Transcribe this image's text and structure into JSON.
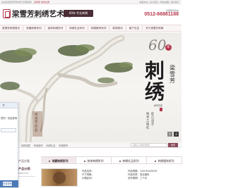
{
  "topbar": {
    "welcome": "欢迎来到梁雪芳刺绣艺术网官网！",
    "login": "请登录",
    "register": "免费注册",
    "links": "收藏本站 | 设为首页 | 网站地图 | 联系我们"
  },
  "header": {
    "logo_text": "梁雪芳刺绣艺术网",
    "logo_sub": "LIANGXUEFANG EMBROIDERY ART",
    "slogan": "60年·专业刺绣",
    "hotline_label": "全国服务热线",
    "hotline_number": "0512-66881188"
  },
  "nav": {
    "items": [
      "梁雪芳刺绣首页",
      "收藏刺绣系列",
      "装饰刺绣系列",
      "刺绣礼品系列",
      "刺绣服饰系列",
      "新闻资讯",
      "客户见证",
      "关于梁雪芳刺绣"
    ]
  },
  "banner": {
    "big_number": "60",
    "nian": "年",
    "title": "刺绣",
    "artist": "梁雪芳",
    "signature": "梁雪芳题",
    "vertical_1": "匠心设计",
    "vertical_2": "纯手工制作",
    "caption": "梁雪芳作品",
    "pages": [
      "1",
      "2"
    ]
  },
  "popup": {
    "close": "×",
    "text": "您好！欢迎咨询",
    "button": "在线咨询"
  },
  "strip": {
    "links": "刺绣收藏   刺绣装饰   刺绣礼品   刺绣服饰",
    "search_placeholder": "请输入关键词搜索",
    "search_button": "搜索"
  },
  "catbar": {
    "left_label": "产品分类",
    "tabs": [
      "收藏刺绣系列",
      "装饰刺绣系列",
      "刺绣礼品系列",
      "刺绣服饰系列"
    ]
  },
  "products": {
    "side_title": "产品分类",
    "side_sub": "PRODUCT",
    "info_col1": [
      "作品名称：",
      "尺寸规格：",
      "价格区间："
    ],
    "info_col2": [
      "作品规格：120CM×80CM",
      "作品材质：真丝面料",
      "创作周期：三个月"
    ]
  }
}
